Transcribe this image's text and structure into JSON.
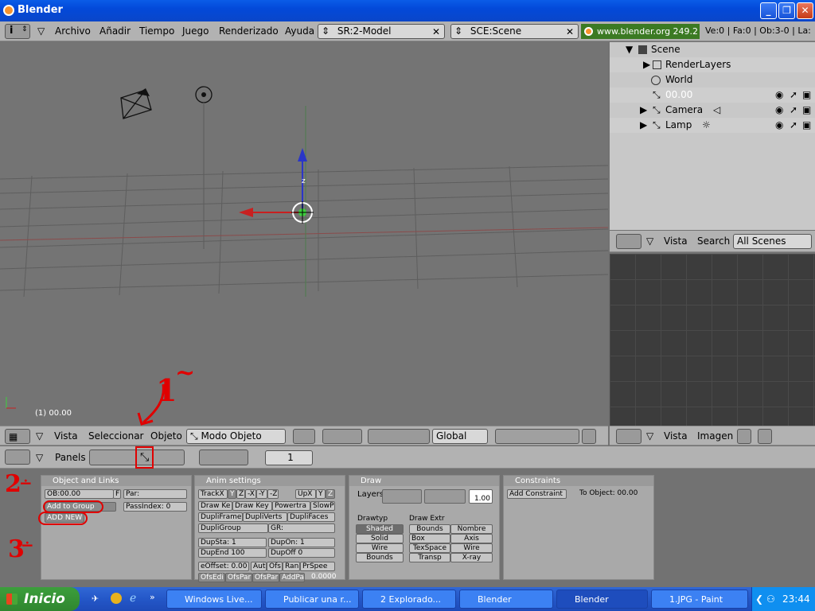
{
  "window": {
    "title": "Blender"
  },
  "menubar": {
    "items": [
      "Archivo",
      "Añadir",
      "Tiempo",
      "Juego",
      "Renderizado",
      "Ayuda"
    ],
    "screen": "SR:2-Model",
    "scene": "SCE:Scene",
    "url": "www.blender.org 249.2",
    "stats": "Ve:0 | Fa:0 | Ob:3-0 | La:"
  },
  "outliner": {
    "rows": [
      "Scene",
      "RenderLayers",
      "World",
      "00.00",
      "Camera",
      "Lamp"
    ],
    "header": {
      "view": "Vista",
      "search": "Search",
      "scenes": "All Scenes"
    }
  },
  "viewport": {
    "frame_label": "(1) 00.00",
    "axis_z": "z",
    "header": {
      "view": "Vista",
      "select": "Seleccionar",
      "object": "Objeto",
      "mode": "Modo Objeto",
      "orientation": "Global"
    }
  },
  "image_header": {
    "view": "Vista",
    "image": "Imagen"
  },
  "buttons_header": {
    "panels": "Panels",
    "frame": "1"
  },
  "object_links": {
    "title": "Object and Links",
    "ob_name": "OB:00.00",
    "f": "F",
    "par": "Par:",
    "add_to_group": "Add to Group",
    "add_new": "ADD NEW",
    "pass_index": "PassIndex: 0"
  },
  "anim": {
    "title": "Anim settings",
    "trackx": "TrackX",
    "y": "Y",
    "z": "Z",
    "mx": "-X",
    "my": "-Y",
    "mz": "-Z",
    "upx": "UpX",
    "upy": "Y",
    "upz": "Z",
    "drawkey": "Draw Ke",
    "drawkey2": "Draw Key",
    "powertrack": "Powertra",
    "slowp": "SlowP",
    "dupliframe": "DupliFrame",
    "dupliverts": "DupliVerts",
    "duplifaces": "DupliFaces",
    "dupligroup": "DupliGroup",
    "gr": "GR:",
    "dupsta": "DupSta: 1",
    "dupon": "DupOn: 1",
    "dupend": "DupEnd 100",
    "dupoff": "DupOff 0",
    "toffset": "eOffset: 0.00",
    "aut": "Aut",
    "ofs": "Ofs",
    "ran": "Ran",
    "prspee": "PrSpee",
    "ofsedi": "OfsEdi",
    "ofspar": "OfsPar",
    "ofspar2": "OfsPar",
    "addpa": "AddPa",
    "val": "0.0000"
  },
  "draw": {
    "title": "Draw",
    "layers": "Layers",
    "scale": "1.00",
    "drawtype": "Drawtyp",
    "drawextra": "Draw Extr",
    "types": [
      "Shaded",
      "Solid",
      "Wire",
      "Bounds"
    ],
    "extras": [
      "Bounds",
      "Nombre",
      "Box",
      "Axis",
      "TexSpace",
      "Wire",
      "Transp",
      "X-ray"
    ]
  },
  "constraints": {
    "title": "Constraints",
    "add": "Add Constraint",
    "to_object": "To Object: 00.00"
  },
  "annotations": {
    "one": "1",
    "two": "2",
    "three": "3"
  },
  "taskbar": {
    "start": "Inicio",
    "tasks": [
      "Windows Live...",
      "Publicar una r...",
      "2 Explorado...",
      "Blender",
      "Blender",
      "1.JPG - Paint"
    ],
    "clock": "23:44"
  },
  "colors": {
    "title_bar": "#0a5ce8",
    "taskbar": "#2457c8",
    "start": "#3c9e3c",
    "annotation": "#e00000"
  }
}
